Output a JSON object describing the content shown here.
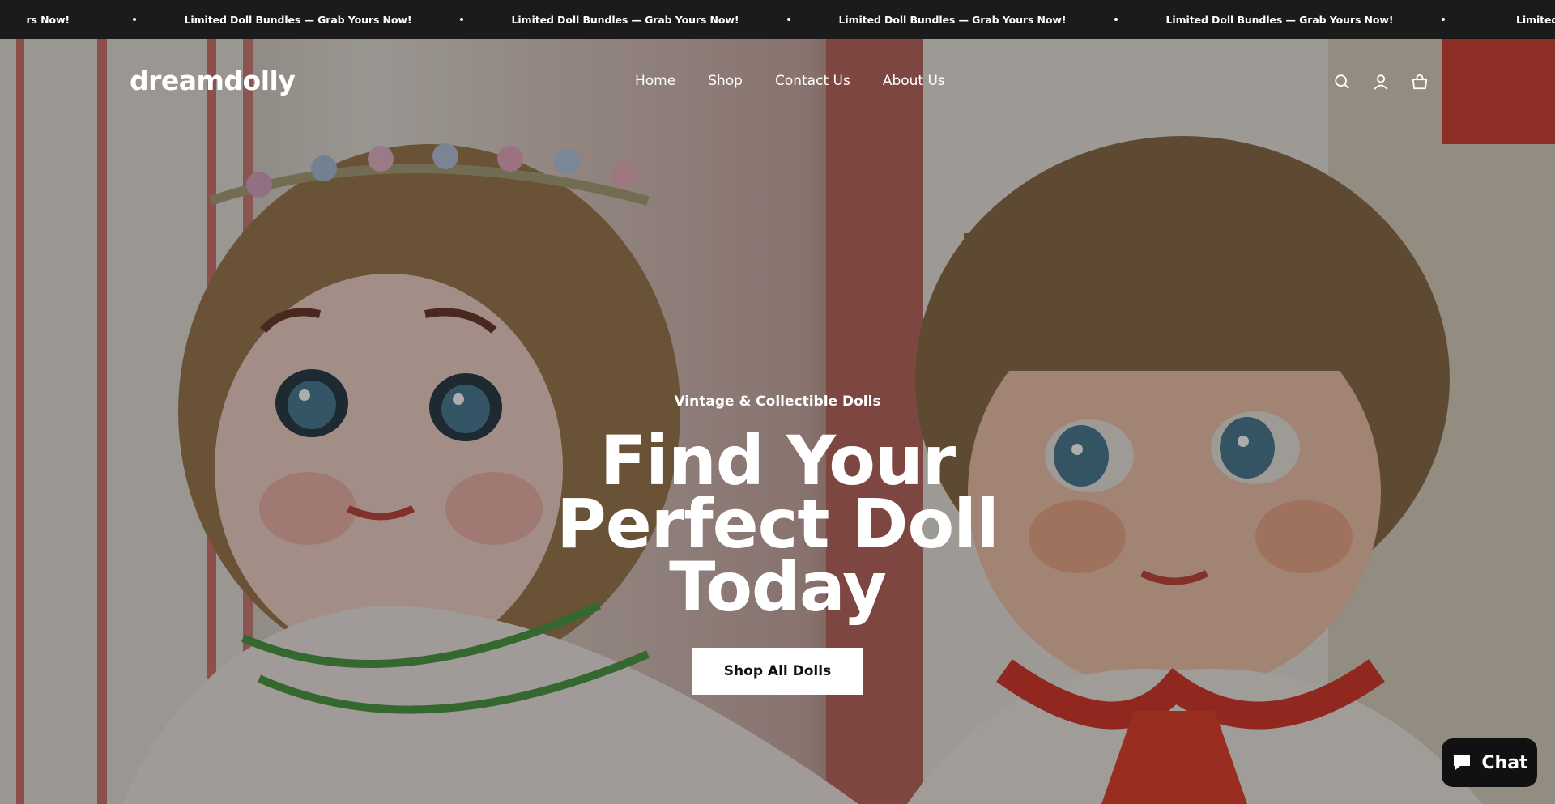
{
  "announcement": {
    "message": "Limited Doll Bundles — Grab Yours Now!",
    "partial_left": "rs Now!",
    "partial_right": "Limited Doll Bundle"
  },
  "header": {
    "logo": "dreamdolly",
    "nav": [
      {
        "label": "Home"
      },
      {
        "label": "Shop"
      },
      {
        "label": "Contact Us"
      },
      {
        "label": "About Us"
      }
    ],
    "icons": [
      "search-icon",
      "account-icon",
      "cart-icon"
    ]
  },
  "hero": {
    "subheading": "Vintage & Collectible Dolls",
    "headline": "Find Your Perfect Doll Today",
    "cta_label": "Shop All Dolls",
    "overlay_color": "#000000"
  },
  "chat": {
    "label": "Chat",
    "icon": "chat-bubble-icon"
  },
  "colors": {
    "announcement_bg": "#1b1b1b",
    "text_light": "#ffffff",
    "button_bg": "#ffffff",
    "button_text": "#111111",
    "chat_bg": "#111111"
  }
}
